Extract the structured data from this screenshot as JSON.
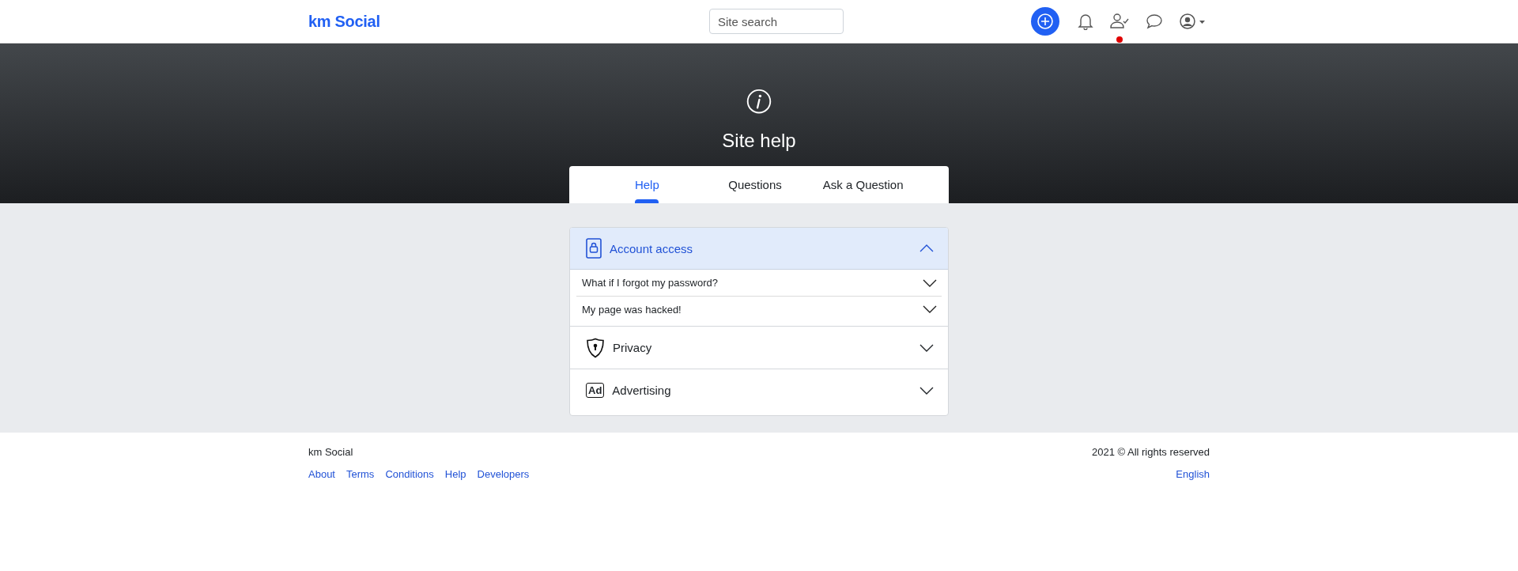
{
  "header": {
    "logo": "km Social",
    "search": {
      "placeholder": "Site search"
    },
    "icons": [
      {
        "kind": "add",
        "badge": false
      },
      {
        "kind": "bell",
        "badge": false
      },
      {
        "kind": "friends",
        "badge": true
      },
      {
        "kind": "chat",
        "badge": false
      },
      {
        "kind": "account",
        "badge": false
      }
    ]
  },
  "hero": {
    "title": "Site help"
  },
  "tabs": [
    {
      "label": "Help",
      "selected": true
    },
    {
      "label": "Questions",
      "selected": false
    },
    {
      "label": "Ask a Question",
      "selected": false
    }
  ],
  "sections": [
    {
      "kind": "lock",
      "title": "Account access",
      "expanded": true,
      "questions": [
        {
          "text": "What if I forgot my password?",
          "expanded": false
        },
        {
          "text": "My page was hacked!",
          "expanded": false
        }
      ]
    },
    {
      "kind": "shield",
      "title": "Privacy",
      "expanded": false
    },
    {
      "kind": "ad",
      "icon_label": "Ad",
      "title": "Advertising",
      "expanded": false
    }
  ],
  "footer": {
    "brand": "km Social",
    "copyright": "2021 © All rights reserved",
    "links": [
      "About",
      "Terms",
      "Conditions",
      "Help",
      "Developers"
    ],
    "language": "English"
  }
}
